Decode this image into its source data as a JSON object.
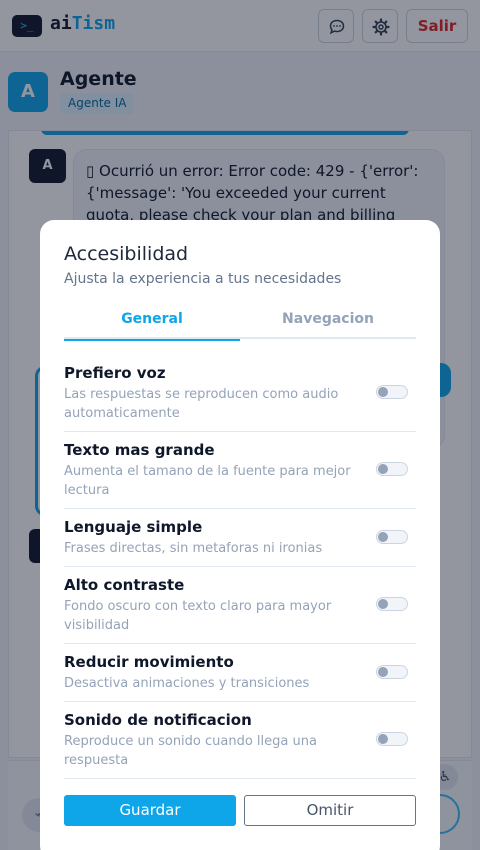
{
  "app": {
    "logo_glyph": ">_",
    "name_part1": "ai",
    "name_part2": "Tism",
    "chat_icon": "chat-bubble-icon",
    "settings_icon": "gear-icon",
    "logout_label": "Salir"
  },
  "agent": {
    "avatar_letter": "A",
    "name": "Agente",
    "badge": "Agente IA"
  },
  "chat": {
    "message_avatar": "A",
    "message_text": "▯ Ocurrió un error: Error code: 429 - {'error': {'message': 'You exceeded your current quota, please check your plan and billing"
  },
  "input": {
    "accessibility_icon": "accessibility-icon",
    "attach_icon": "attach-icon"
  },
  "modal": {
    "title": "Accesibilidad",
    "subtitle": "Ajusta la experiencia a tus necesidades",
    "tabs": [
      {
        "label": "General",
        "active": true
      },
      {
        "label": "Navegacion",
        "active": false
      }
    ],
    "options": [
      {
        "title": "Prefiero voz",
        "desc": "Las respuestas se reproducen como audio automaticamente",
        "enabled": false
      },
      {
        "title": "Texto mas grande",
        "desc": "Aumenta el tamano de la fuente para mejor lectura",
        "enabled": false
      },
      {
        "title": "Lenguaje simple",
        "desc": "Frases directas, sin metaforas ni ironias",
        "enabled": false
      },
      {
        "title": "Alto contraste",
        "desc": "Fondo oscuro con texto claro para mayor visibilidad",
        "enabled": false
      },
      {
        "title": "Reducir movimiento",
        "desc": "Desactiva animaciones y transiciones",
        "enabled": false
      },
      {
        "title": "Sonido de notificacion",
        "desc": "Reproduce un sonido cuando llega una respuesta",
        "enabled": false
      }
    ],
    "save_label": "Guardar",
    "skip_label": "Omitir"
  },
  "colors": {
    "accent": "#0ea5e9",
    "dark": "#0f172a",
    "danger": "#dc2626"
  }
}
